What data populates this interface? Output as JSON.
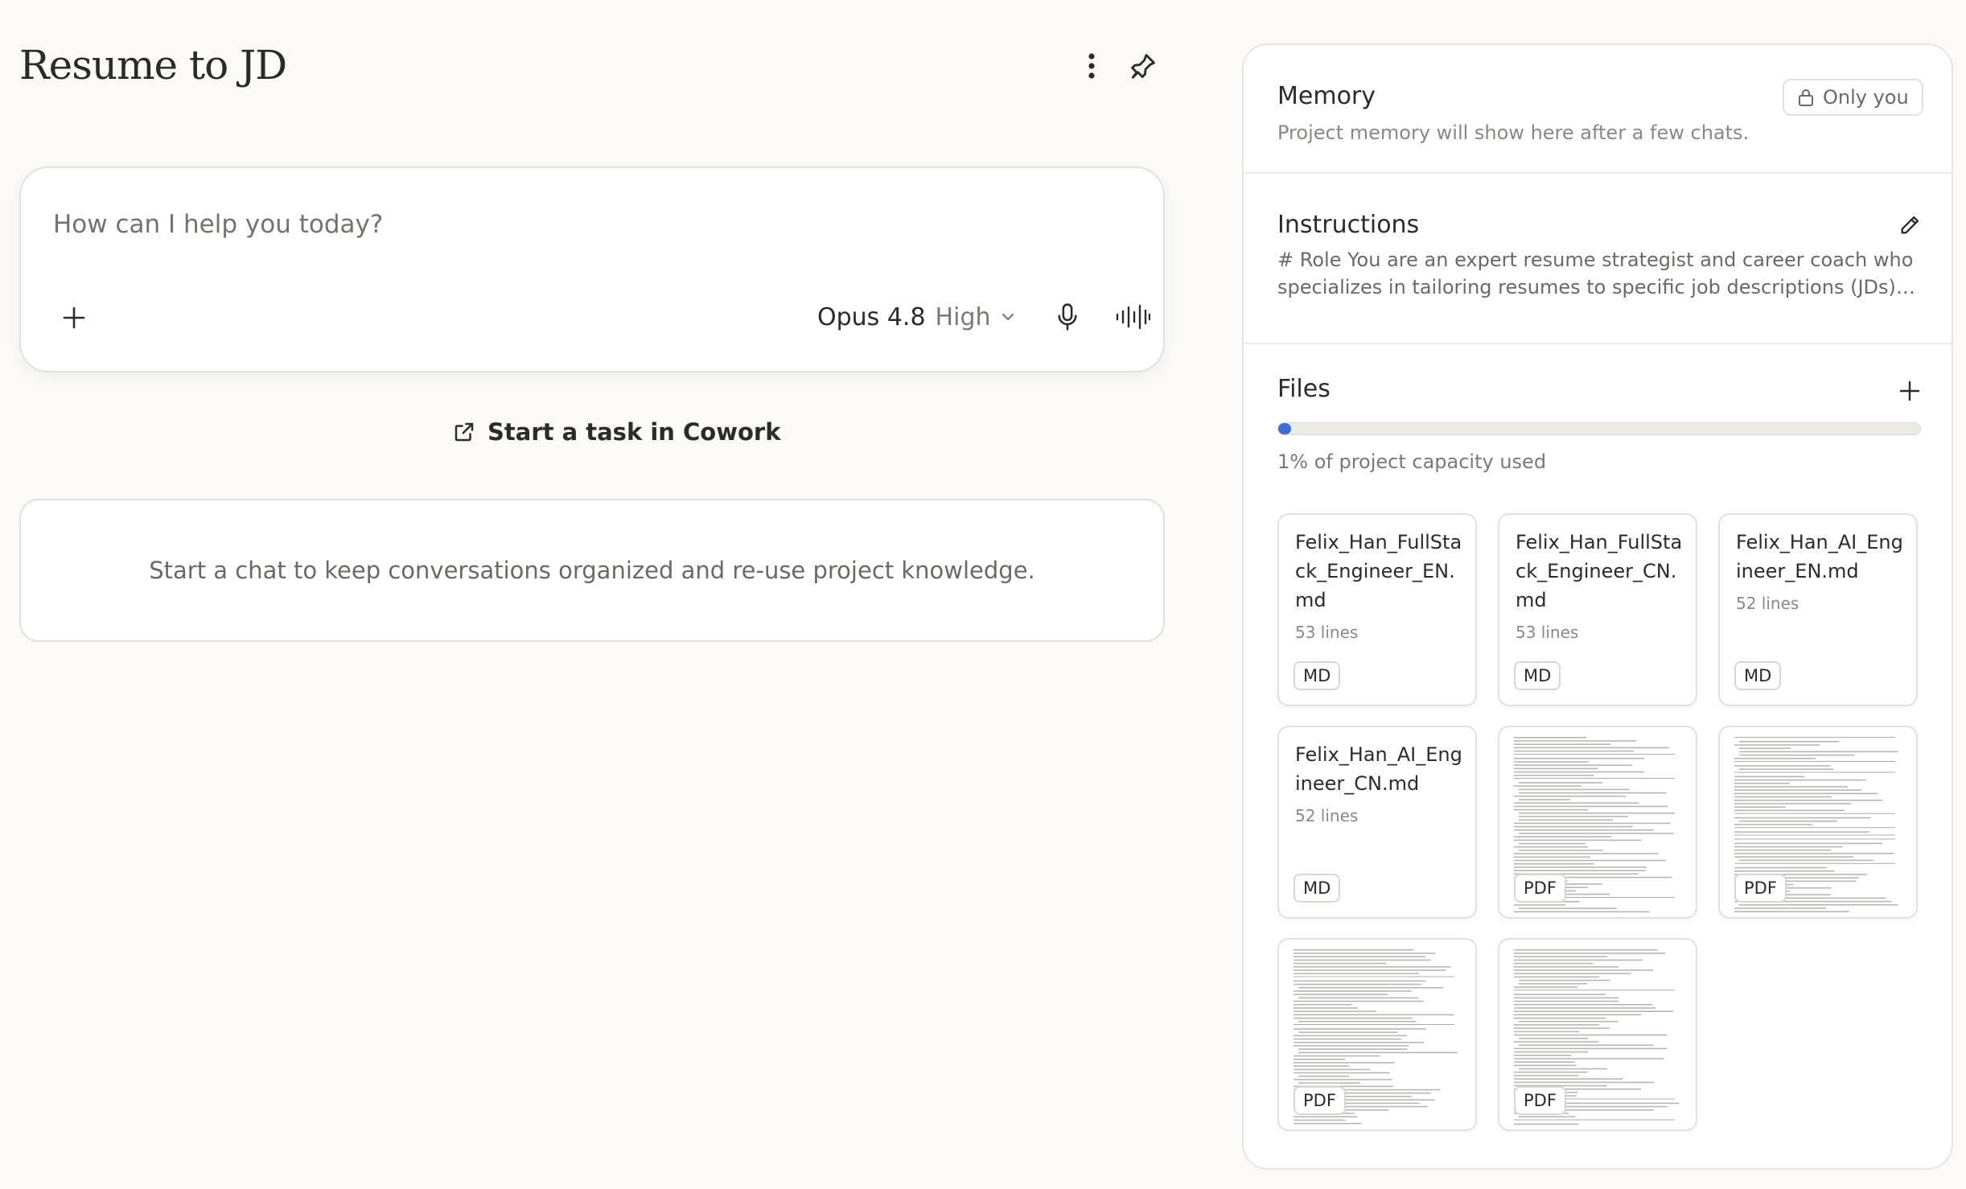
{
  "project": {
    "title": "Resume to JD"
  },
  "composer": {
    "placeholder": "How can I help you today?",
    "model_name": "Opus 4.8",
    "model_effort": "High"
  },
  "cowork": {
    "label": "Start a task in Cowork"
  },
  "empty_state": {
    "text": "Start a chat to keep conversations organized and re-use project knowledge."
  },
  "memory": {
    "title": "Memory",
    "subtitle": "Project memory will show here after a few chats.",
    "visibility_label": "Only you"
  },
  "instructions": {
    "title": "Instructions",
    "preview": "# Role You are an expert resume strategist and career coach who specializes in tailoring resumes to specific job descriptions (JDs) for…"
  },
  "files": {
    "title": "Files",
    "capacity_percent": 1,
    "capacity_text": "1% of project capacity used",
    "items": [
      {
        "name": "Felix_Han_FullStack_Engineer_EN.md",
        "lines": "53 lines",
        "type": "MD"
      },
      {
        "name": "Felix_Han_FullStack_Engineer_CN.md",
        "lines": "53 lines",
        "type": "MD"
      },
      {
        "name": "Felix_Han_AI_Engineer_EN.md",
        "lines": "52 lines",
        "type": "MD"
      },
      {
        "name": "Felix_Han_AI_Engineer_CN.md",
        "lines": "52 lines",
        "type": "MD"
      },
      {
        "type": "PDF"
      },
      {
        "type": "PDF"
      },
      {
        "type": "PDF"
      },
      {
        "type": "PDF"
      }
    ]
  },
  "colors": {
    "accent_blue": "#3d6ed8",
    "background": "#fbfaf8",
    "border": "#e3e1db"
  }
}
